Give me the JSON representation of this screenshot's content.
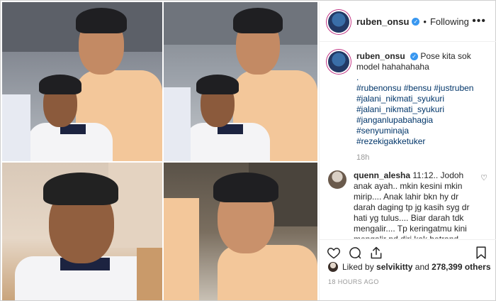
{
  "post": {
    "username": "ruben_onsu",
    "follow_separator": "•",
    "follow_label": "Following",
    "more_label": "•••",
    "caption": {
      "username": "ruben_onsu",
      "text": "Pose kita sok model hahahahaha",
      "dot": ".",
      "hashtags": [
        "#rubenonsu #bensu #justruben",
        "#jalani_nikmati_syukuri",
        "#jalani_nikmati_syukuri",
        "#janganlupabahagia #senyuminaja",
        "#rezekigakketuker"
      ],
      "age": "18h"
    },
    "comments": [
      {
        "username": "quenn_alesha",
        "text": "11:12.. Jodoh anak ayah.. mkin kesini mkin mirip.... Anak lahir bkn hy dr darah daging tp jg kasih syg dr hati yg tulus.... Biar darah tdk mengalir.... Tp keringatmu kini mengalir pd diri kak betrand.. ehhh iyaaa. Akuu nggaa bakalannn punyaa kulittt seputihh dan see glowingg inii."
      }
    ],
    "likes": {
      "prefix": "Liked by",
      "first_user": "selvikitty",
      "middle": "and",
      "count": "278,399 others"
    },
    "timestamp": "18 HOURS AGO"
  },
  "colors": {
    "link": "#003569",
    "verified": "#3897f0",
    "muted": "#999999",
    "story_ring": "#c13584"
  }
}
